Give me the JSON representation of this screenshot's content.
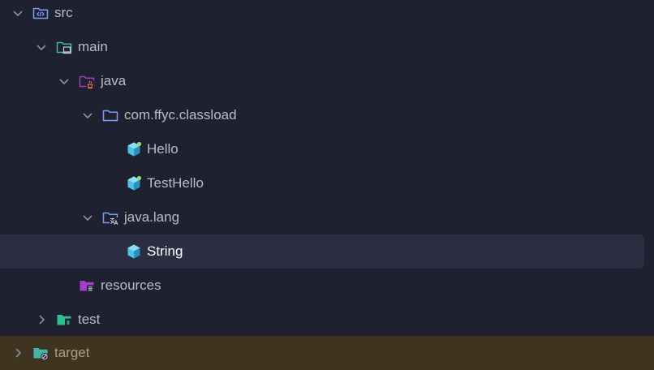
{
  "project_tree": {
    "nodes": [
      {
        "label": "src",
        "icon": "source-root-folder-icon",
        "expanded": true
      },
      {
        "label": "main",
        "icon": "module-folder-icon",
        "expanded": true
      },
      {
        "label": "java",
        "icon": "java-source-folder-icon",
        "expanded": true
      },
      {
        "label": "com.ffyc.classload",
        "icon": "package-folder-icon",
        "expanded": true
      },
      {
        "label": "Hello",
        "icon": "java-class-icon"
      },
      {
        "label": "TestHello",
        "icon": "java-class-icon"
      },
      {
        "label": "java.lang",
        "icon": "package-folder-icon",
        "expanded": true
      },
      {
        "label": "String",
        "icon": "java-class-icon",
        "selected": true
      },
      {
        "label": "resources",
        "icon": "resources-folder-icon"
      },
      {
        "label": "test",
        "icon": "test-folder-icon",
        "expanded": false
      },
      {
        "label": "target",
        "icon": "excluded-folder-icon",
        "expanded": false,
        "excluded": true
      }
    ]
  },
  "colors": {
    "background": "#1f2130",
    "selected_row": "#2b2e40",
    "excluded_row": "#3e3420",
    "text": "#b9bcc6",
    "selected_text": "#ffffff",
    "folder_blue": "#7e9bf2",
    "module_teal": "#3fb8a8",
    "resources_purple": "#a33fc6",
    "java_class_cyan": "#4fc1e9",
    "test_green": "#2dbf8c"
  }
}
